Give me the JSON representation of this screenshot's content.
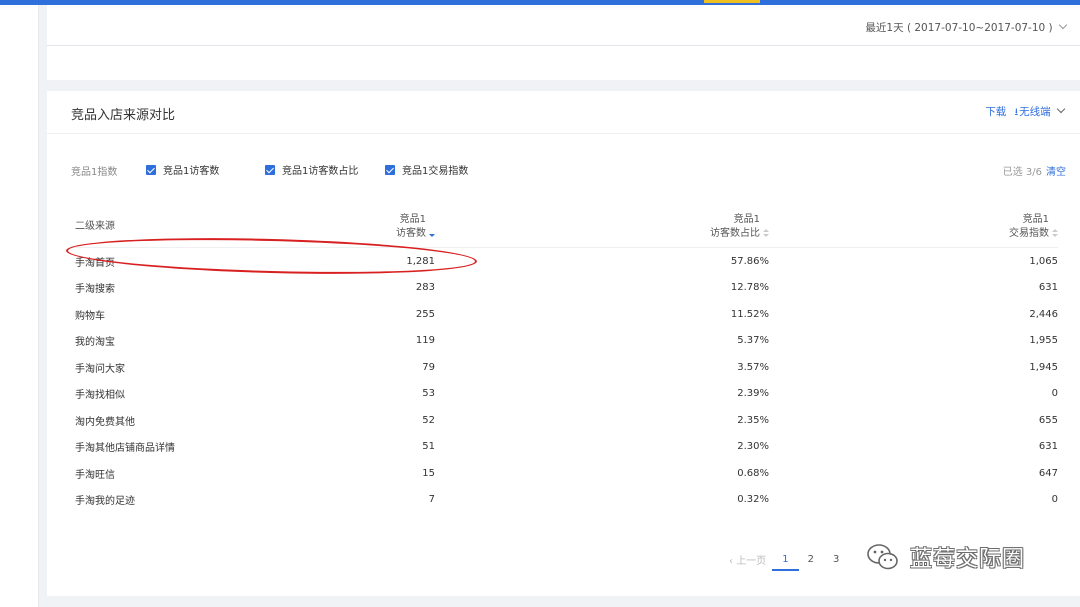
{
  "date_filter": {
    "label": "最近1天",
    "range": "( 2017-07-10~2017-07-10 )"
  },
  "panel": {
    "title": "竞品入店来源对比",
    "download_label": "下载",
    "device_label": "无线端"
  },
  "filters": {
    "group_label": "竞品1指数",
    "options": [
      {
        "label": "竞品1访客数",
        "checked": true
      },
      {
        "label": "竞品1访客数占比",
        "checked": true
      },
      {
        "label": "竞品1交易指数",
        "checked": true
      }
    ],
    "selected_text": "已选 3/6",
    "clear_label": "清空"
  },
  "table": {
    "columns": [
      {
        "line1": "二级来源",
        "line2": ""
      },
      {
        "line1": "竞品1",
        "line2": "访客数"
      },
      {
        "line1": "竞品1",
        "line2": "访客数占比"
      },
      {
        "line1": "竞品1",
        "line2": "交易指数"
      }
    ],
    "rows": [
      {
        "source": "手淘首页",
        "visitors": "1,281",
        "share": "57.86%",
        "trade_index": "1,065"
      },
      {
        "source": "手淘搜索",
        "visitors": "283",
        "share": "12.78%",
        "trade_index": "631"
      },
      {
        "source": "购物车",
        "visitors": "255",
        "share": "11.52%",
        "trade_index": "2,446"
      },
      {
        "source": "我的淘宝",
        "visitors": "119",
        "share": "5.37%",
        "trade_index": "1,955"
      },
      {
        "source": "手淘问大家",
        "visitors": "79",
        "share": "3.57%",
        "trade_index": "1,945"
      },
      {
        "source": "手淘找相似",
        "visitors": "53",
        "share": "2.39%",
        "trade_index": "0"
      },
      {
        "source": "淘内免费其他",
        "visitors": "52",
        "share": "2.35%",
        "trade_index": "655"
      },
      {
        "source": "手淘其他店铺商品详情",
        "visitors": "51",
        "share": "2.30%",
        "trade_index": "631"
      },
      {
        "source": "手淘旺信",
        "visitors": "15",
        "share": "0.68%",
        "trade_index": "647"
      },
      {
        "source": "手淘我的足迹",
        "visitors": "7",
        "share": "0.32%",
        "trade_index": "0"
      }
    ]
  },
  "pagination": {
    "prev_label": "上一页",
    "pages": [
      "1",
      "2",
      "3"
    ],
    "current": "1"
  },
  "watermark": {
    "icon": "wechat-icon",
    "text": "蓝莓交际圈"
  },
  "colors": {
    "accent": "#2f6fdc",
    "highlight": "#d82020"
  }
}
